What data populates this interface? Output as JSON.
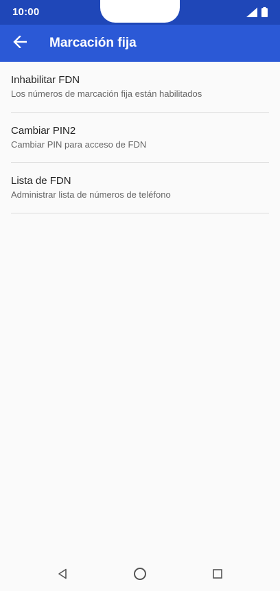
{
  "status_bar": {
    "time": "10:00",
    "icons": [
      "signal-icon",
      "battery-icon"
    ]
  },
  "app_bar": {
    "back_icon": "arrow-left-icon",
    "title": "Marcación fija",
    "accent_color": "#2b59d6",
    "status_color": "#1f47b8"
  },
  "settings": {
    "items": [
      {
        "title": "Inhabilitar FDN",
        "summary": "Los números de marcación fija están habilitados"
      },
      {
        "title": "Cambiar PIN2",
        "summary": "Cambiar PIN para acceso de FDN"
      },
      {
        "title": "Lista de FDN",
        "summary": "Administrar lista de números de teléfono"
      }
    ]
  },
  "nav_bar": {
    "icons": [
      "back-triangle-icon",
      "home-circle-icon",
      "recents-square-icon"
    ]
  }
}
